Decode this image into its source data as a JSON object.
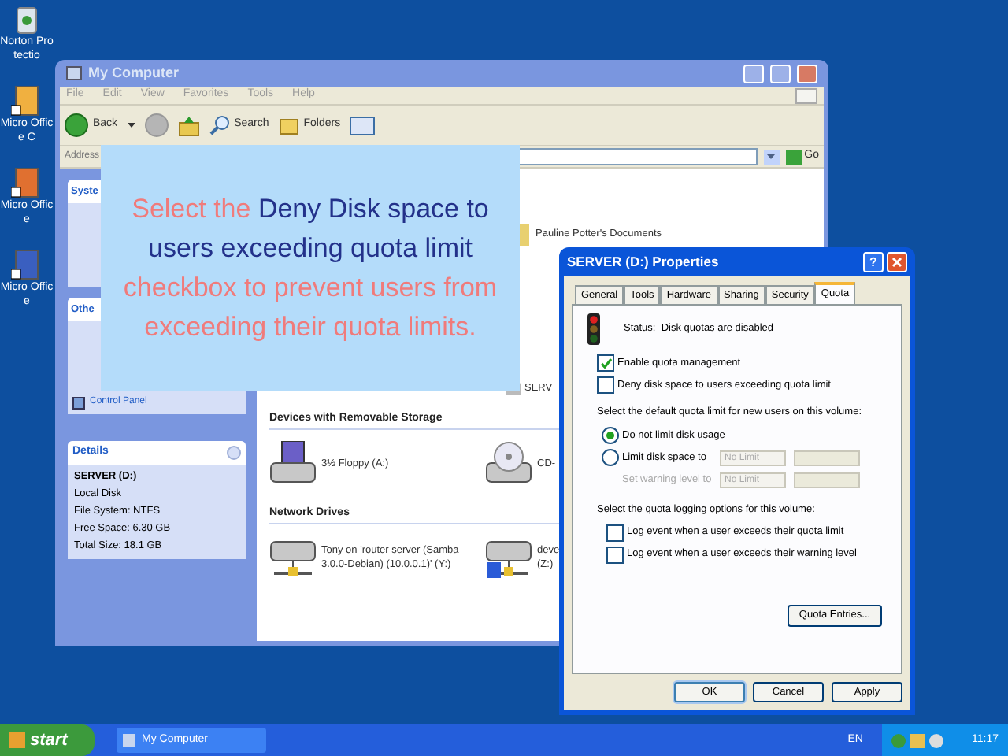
{
  "desktop_icons": [
    {
      "label": "Norton Protectio"
    },
    {
      "label": "Micro Office C"
    },
    {
      "label": "Micro Office"
    },
    {
      "label": "Micro Office"
    }
  ],
  "explorer": {
    "title": "My Computer",
    "menu": [
      "File",
      "Edit",
      "View",
      "Favorites",
      "Tools",
      "Help"
    ],
    "toolbar": {
      "back": "Back",
      "search": "Search",
      "folders": "Folders"
    },
    "address": {
      "label": "Address",
      "go": "Go"
    },
    "task_panels": [
      {
        "title": "Syste"
      },
      {
        "title": "Othe",
        "link": "Control Panel"
      }
    ],
    "details": {
      "title": "Details",
      "name": "SERVER (D:)",
      "lines": [
        "Local Disk",
        "File System: NTFS",
        "Free Space: 6.30 GB",
        "Total Size: 18.1 GB"
      ]
    },
    "documents_item": "Pauline Potter's Documents",
    "drive_item": "SERV",
    "sections": [
      {
        "title": "Devices with Removable Storage",
        "items": [
          {
            "kind": "floppy",
            "label": "3½ Floppy (A:)"
          },
          {
            "kind": "cd",
            "label": "CD-"
          }
        ]
      },
      {
        "title": "Network Drives",
        "items": [
          {
            "kind": "network",
            "label": "Tony on 'router server (Samba 3.0.0-Debian) (10.0.0.1)' (Y:)"
          },
          {
            "kind": "network-sync",
            "label": "deve (Z:)"
          }
        ]
      }
    ]
  },
  "callout": {
    "segments": [
      {
        "text": "Select the ",
        "kind": "plain"
      },
      {
        "text": "Deny Disk space to users exceeding quota limit",
        "kind": "emphasis"
      },
      {
        "text": " checkbox to prevent users from exceeding their quota limits.",
        "kind": "plain"
      }
    ]
  },
  "dialog": {
    "title": "SERVER (D:) Properties",
    "help": "?",
    "tabs": [
      {
        "label": "General",
        "selected": false
      },
      {
        "label": "Tools",
        "selected": false
      },
      {
        "label": "Hardware",
        "selected": false
      },
      {
        "label": "Sharing",
        "selected": false
      },
      {
        "label": "Security",
        "selected": false
      },
      {
        "label": "Quota",
        "selected": true
      }
    ],
    "status": "Status:  Disk quotas are disabled",
    "quota_checks": [
      {
        "label": "Enable quota management",
        "checked": true
      },
      {
        "label": "Deny disk space to users exceeding quota limit",
        "checked": false
      }
    ],
    "default_label": "Select the default quota limit for new users on this volume:",
    "radios": [
      {
        "label": "Do not limit disk usage",
        "selected": true
      },
      {
        "label": "Limit disk space to",
        "selected": false,
        "value": "No Limit"
      }
    ],
    "warning": {
      "label": "Set warning level to",
      "value": "No Limit",
      "disabled": true
    },
    "logging_label": "Select the quota logging options for this volume:",
    "log_checks": [
      {
        "label": "Log event when a user exceeds their quota limit",
        "checked": false
      },
      {
        "label": "Log event when a user exceeds their warning level",
        "checked": false
      }
    ],
    "entries_button": "Quota Entries...",
    "buttons": [
      "OK",
      "Cancel",
      "Apply"
    ]
  },
  "taskbar": {
    "start": "start",
    "task": "My Computer",
    "language": "EN",
    "time": "11:17"
  }
}
